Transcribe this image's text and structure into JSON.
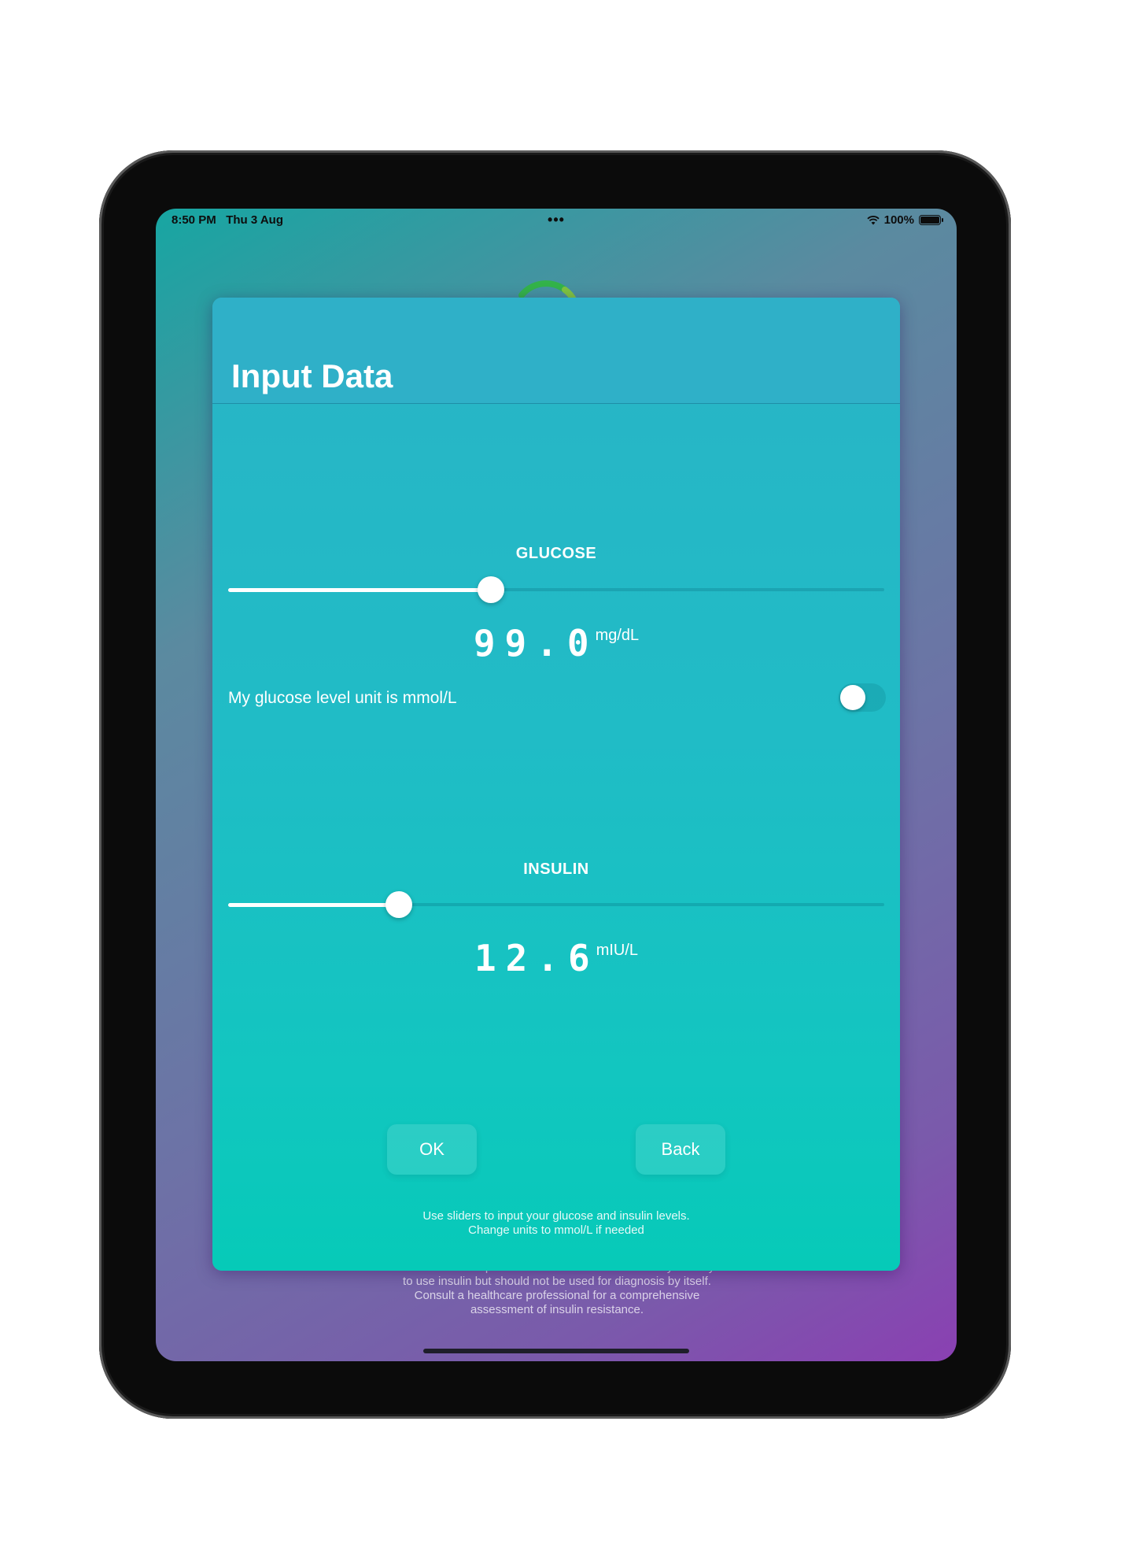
{
  "status_bar": {
    "time": "8:50 PM",
    "date": "Thu 3 Aug",
    "multitask": "•••",
    "battery": "100%"
  },
  "background": {
    "disclaimer_lines": [
      "HOMA-IR index provides information about the body's ability",
      "to use insulin but should not be used for diagnosis by itself.",
      "Consult a healthcare professional for a comprehensive",
      "assessment of insulin resistance."
    ]
  },
  "sheet": {
    "title": "Input Data",
    "glucose": {
      "label": "GLUCOSE",
      "value": "99.0",
      "unit": "mg/dL",
      "slider_fraction": 0.4
    },
    "unit_toggle": {
      "label": "My glucose level unit is mmol/L",
      "on": false
    },
    "insulin": {
      "label": "INSULIN",
      "value": "12.6",
      "unit": "mIU/L",
      "slider_fraction": 0.26
    },
    "buttons": {
      "ok": "OK",
      "back": "Back"
    },
    "hint_lines": [
      "Use sliders to input your glucose and insulin levels.",
      "Change units to mmol/L if needed"
    ]
  },
  "colors": {
    "accent": "#ffffff",
    "sheet_top": "#2fb0c8",
    "sheet_bottom": "#06cab8",
    "bg_purple": "#8a40b2"
  }
}
